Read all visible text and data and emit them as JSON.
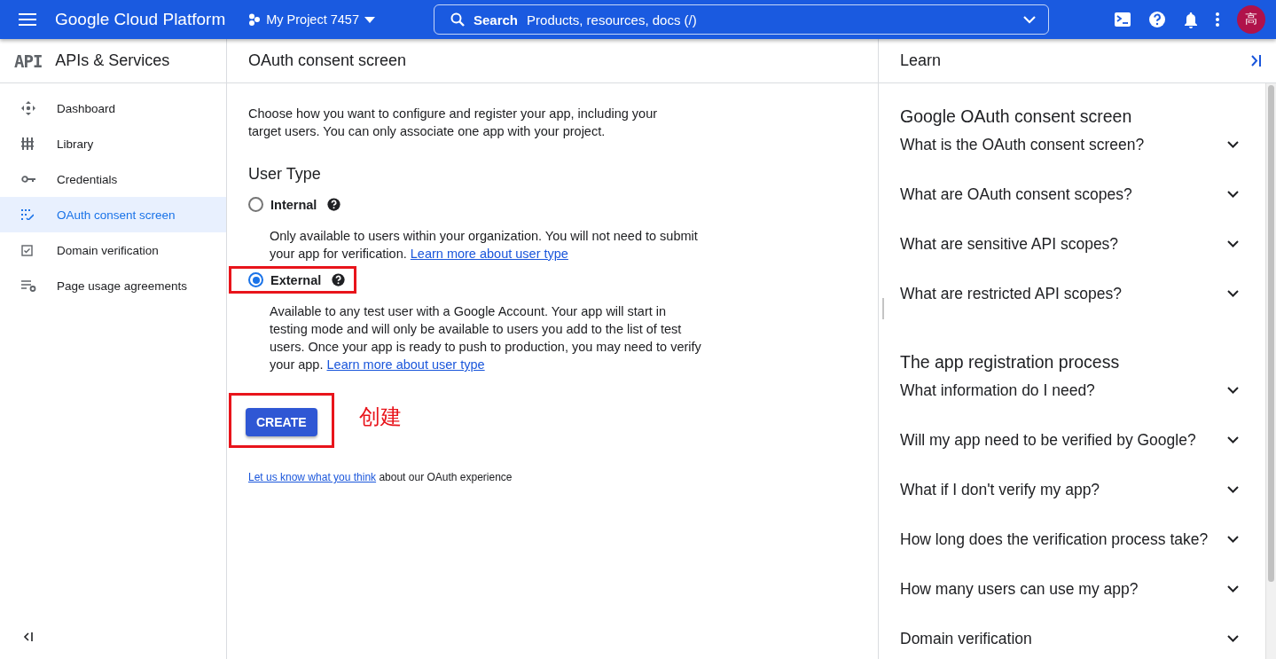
{
  "topbar": {
    "product": "Google Cloud Platform",
    "project": "My Project 7457",
    "search": {
      "label": "Search",
      "placeholder": "Products, resources, docs (/)"
    },
    "avatar": "高"
  },
  "sidebar": {
    "title": "APIs & Services",
    "logo": "API",
    "items": [
      {
        "label": "Dashboard",
        "selected": false
      },
      {
        "label": "Library",
        "selected": false
      },
      {
        "label": "Credentials",
        "selected": false
      },
      {
        "label": "OAuth consent screen",
        "selected": true
      },
      {
        "label": "Domain verification",
        "selected": false
      },
      {
        "label": "Page usage agreements",
        "selected": false
      }
    ]
  },
  "main": {
    "title": "OAuth consent screen",
    "intro": "Choose how you want to configure and register your app, including your target users. You can only associate one app with your project.",
    "section": "User Type",
    "options": [
      {
        "label": "Internal",
        "selected": false,
        "highlighted": false,
        "description": "Only available to users within your organization. You will not need to submit your app for verification.",
        "link": "Learn more about user type"
      },
      {
        "label": "External",
        "selected": true,
        "highlighted": true,
        "description": "Available to any test user with a Google Account. Your app will start in testing mode and will only be available to users you add to the list of test users. Once your app is ready to push to production, you may need to verify your app.",
        "link": "Learn more about user type"
      }
    ],
    "create_button": {
      "label": "CREATE",
      "highlighted": true
    },
    "annotation": "创建",
    "feedback": {
      "link": "Let us know what you think",
      "text": " about our OAuth experience"
    }
  },
  "learn": {
    "title": "Learn",
    "sections": [
      {
        "heading": "Google OAuth consent screen",
        "items": [
          {
            "label": "What is the OAuth consent screen?",
            "expanded": false
          },
          {
            "label": "What are OAuth consent scopes?",
            "expanded": false
          },
          {
            "label": "What are sensitive API scopes?",
            "expanded": false
          },
          {
            "label": "What are restricted API scopes?",
            "expanded": false
          }
        ]
      },
      {
        "heading": "The app registration process",
        "items": [
          {
            "label": "What information do I need?",
            "expanded": false
          },
          {
            "label": "Will my app need to be verified by Google?",
            "expanded": false
          },
          {
            "label": "What if I don't verify my app?",
            "expanded": false
          },
          {
            "label": "How long does the verification process take?",
            "expanded": false
          },
          {
            "label": "How many users can use my app?",
            "expanded": false
          },
          {
            "label": "Domain verification",
            "expanded": false
          }
        ]
      }
    ]
  }
}
